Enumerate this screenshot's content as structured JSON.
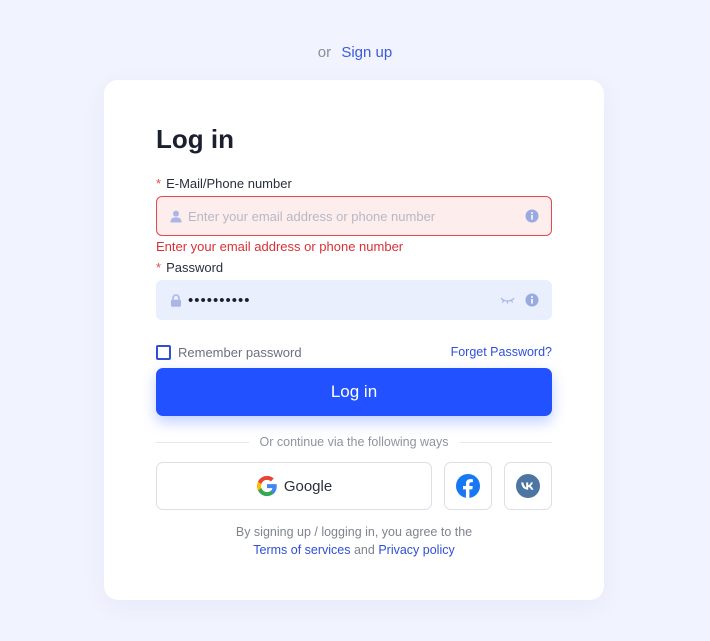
{
  "top": {
    "or_text": "or",
    "signup_label": "Sign up"
  },
  "form": {
    "title": "Log in",
    "email": {
      "label": "E-Mail/Phone number",
      "required_mark": "*",
      "placeholder": "Enter your email address or phone number",
      "value": "",
      "error": "Enter your email address or phone number"
    },
    "password": {
      "label": "Password",
      "required_mark": "*",
      "value": "••••••••••"
    },
    "remember_label": "Remember password",
    "forget_label": "Forget Password?",
    "login_button": "Log in",
    "divider_text": "Or continue via the following ways",
    "social": {
      "google_label": "Google"
    },
    "terms": {
      "prefix": "By signing up / logging in, you agree to the",
      "terms_link": "Terms of services",
      "and": "and",
      "privacy_link": "Privacy policy"
    }
  },
  "icons": {
    "user": "user-icon",
    "info": "info-icon",
    "lock": "lock-icon",
    "eye_closed": "eye-closed-icon",
    "google": "google-icon",
    "facebook": "facebook-icon",
    "vk": "vk-icon"
  },
  "colors": {
    "primary": "#2251ff",
    "link": "#2f4fd8",
    "error": "#e5484d",
    "background": "#f1f3fe",
    "facebook": "#1877f2",
    "vk": "#4c75a3"
  }
}
